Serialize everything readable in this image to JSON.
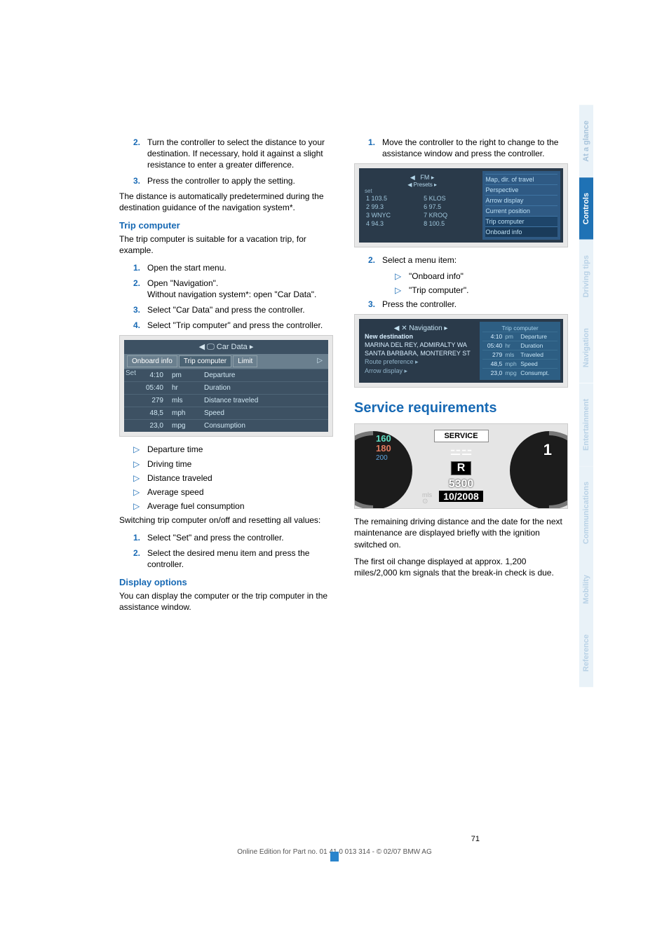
{
  "left": {
    "steps1": [
      "Turn the controller to select the distance to your destination. If necessary, hold it against a slight resistance to enter a greater difference.",
      "Press the controller to apply the setting."
    ],
    "steps1_start": 2,
    "post_steps1": "The distance is automatically predetermined during the destination guidance of the navigation system*.",
    "trip_h": "Trip computer",
    "trip_p": "The trip computer is suitable for a vacation trip, for example.",
    "trip_steps": [
      "Open the start menu.",
      "Open \"Navigation\".\nWithout navigation system*: open \"Car Data\".",
      "Select \"Car Data\" and press the controller.",
      "Select \"Trip computer\" and press the controller."
    ],
    "cardata": {
      "title": "Car Data",
      "tabs": [
        "Onboard info",
        "Trip computer",
        "Limit"
      ],
      "set": "Set",
      "rows": [
        {
          "v": "4:10",
          "u": "pm",
          "l": "Departure"
        },
        {
          "v": "05:40",
          "u": "hr",
          "l": "Duration"
        },
        {
          "v": "279",
          "u": "mls",
          "l": "Distance traveled"
        },
        {
          "v": "48,5",
          "u": "mph",
          "l": "Speed"
        },
        {
          "v": "23,0",
          "u": "mpg",
          "l": "Consumption"
        }
      ]
    },
    "bullets": [
      "Departure time",
      "Driving time",
      "Distance traveled",
      "Average speed",
      "Average fuel consumption"
    ],
    "switch_p": "Switching trip computer on/off and resetting all values:",
    "switch_steps": [
      "Select \"Set\" and press the controller.",
      "Select the desired menu item and press the controller."
    ],
    "disp_h": "Display options",
    "disp_p": "You can display the computer or the trip computer in the assistance window."
  },
  "right": {
    "step1": "Move the controller to the right to change to the assistance window and press the controller.",
    "radio": {
      "top": "FM",
      "presets": "Presets",
      "set": "set",
      "rows": [
        [
          "1 103.5",
          "5 KLOS"
        ],
        [
          "2 99.3",
          "6 97.5"
        ],
        [
          "3 WNYC",
          "7 KROQ"
        ],
        [
          "4 94.3",
          "8 100.5"
        ]
      ],
      "side": [
        "Map, dir. of travel",
        "Perspective",
        "Arrow display",
        "Current position",
        "Trip computer",
        "Onboard info"
      ]
    },
    "menu_intro": "Select a menu item:",
    "menu_bullets": [
      "\"Onboard info\"",
      "\"Trip computer\"."
    ],
    "step3": "Press the controller.",
    "nav2": {
      "hdr": "Navigation",
      "rhdr": "Trip computer",
      "newdest": "New destination",
      "dests": [
        "MARINA DEL REY, ADMIRALTY WA",
        "SANTA BARBARA, MONTERREY ST"
      ],
      "rp": "Route preference",
      "ad": "Arrow display",
      "side": [
        {
          "v": "4:10",
          "u": "pm",
          "l": "Departure"
        },
        {
          "v": "05:40",
          "u": "hr",
          "l": "Duration"
        },
        {
          "v": "279",
          "u": "mls",
          "l": "Traveled"
        },
        {
          "v": "48,5",
          "u": "mph",
          "l": "Speed"
        },
        {
          "v": "23,0",
          "u": "mpg",
          "l": "Consumpt."
        }
      ]
    },
    "service_h": "Service requirements",
    "service": {
      "label": "SERVICE",
      "gear": "R",
      "miles": "5300",
      "date": "10/2008",
      "mls_lbl": "mls",
      "left_ticks": [
        "160",
        "180",
        "200"
      ],
      "right1": "1",
      "clock": "⊙"
    },
    "service_p1": "The remaining driving distance and the date for the next maintenance are displayed briefly with the ignition switched on.",
    "service_p2": "The first oil change displayed at approx. 1,200 miles/2,000 km signals that the break-in check is due."
  },
  "sidebar": [
    "At a glance",
    "Controls",
    "Driving tips",
    "Navigation",
    "Entertainment",
    "Communications",
    "Mobility",
    "Reference"
  ],
  "footer": "Online Edition for Part no. 01 41 0 013 314 - © 02/07 BMW AG",
  "pagenum": "71"
}
